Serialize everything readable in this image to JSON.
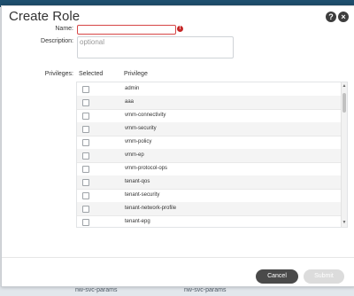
{
  "dialog": {
    "title": "Create Role",
    "help_icon": "?",
    "close_icon": "×"
  },
  "form": {
    "name_label": "Name:",
    "name_value": "",
    "error_icon": "!",
    "description_label": "Description:",
    "description_placeholder": "optional",
    "privileges_label": "Privileges:"
  },
  "table": {
    "columns": [
      "Selected",
      "Privilege"
    ],
    "rows": [
      {
        "privilege": "admin"
      },
      {
        "privilege": "aaa"
      },
      {
        "privilege": "vmm-connectivity"
      },
      {
        "privilege": "vmm-security"
      },
      {
        "privilege": "vmm-policy"
      },
      {
        "privilege": "vmm-ep"
      },
      {
        "privilege": "vmm-protocol-ops"
      },
      {
        "privilege": "tenant-qos"
      },
      {
        "privilege": "tenant-security"
      },
      {
        "privilege": "tenant-network-profile"
      },
      {
        "privilege": "tenant-epg"
      }
    ]
  },
  "buttons": {
    "cancel": "Cancel",
    "submit": "Submit"
  },
  "background": {
    "cells": [
      "nw-svc-params",
      "nw-svc-params"
    ]
  },
  "colors": {
    "accent": "#4a4a4a",
    "error": "#c62828"
  }
}
